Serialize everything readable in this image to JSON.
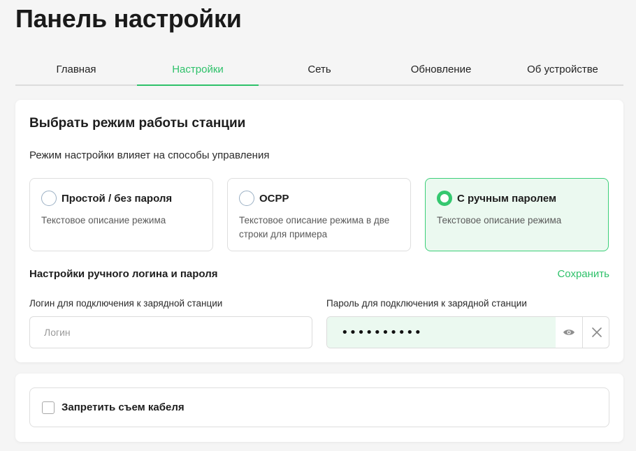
{
  "page": {
    "title": "Панель настройки"
  },
  "tabs": [
    {
      "label": "Главная",
      "active": false
    },
    {
      "label": "Настройки",
      "active": true
    },
    {
      "label": "Сеть",
      "active": false
    },
    {
      "label": "Обновление",
      "active": false
    },
    {
      "label": "Об устройстве",
      "active": false
    }
  ],
  "mode_section": {
    "title": "Выбрать режим работы станции",
    "subtitle": "Режим настройки влияет на способы управления",
    "options": [
      {
        "label": "Простой / без пароля",
        "description": "Текстовое описание режима",
        "selected": false
      },
      {
        "label": "OCPP",
        "description": "Текстовое описание режима в две строки для примера",
        "selected": false
      },
      {
        "label": "С ручным паролем",
        "description": "Текстовое описание режима",
        "selected": true
      }
    ]
  },
  "manual_section": {
    "title": "Настройки ручного логина и пароля",
    "save_label": "Сохранить",
    "login": {
      "label": "Логин для подключения к зарядной станции",
      "placeholder": "Логин",
      "value": ""
    },
    "password": {
      "label": "Пароль для подключения к зарядной станции",
      "value": "••••••••••",
      "show_icon": "eye-icon",
      "clear_icon": "close-icon"
    }
  },
  "cable_section": {
    "label": "Запретить съем кабеля",
    "checked": false
  },
  "colors": {
    "accent": "#2ec16a",
    "selected_bg": "#ebf9f0",
    "page_bg": "#f5f5f5"
  }
}
